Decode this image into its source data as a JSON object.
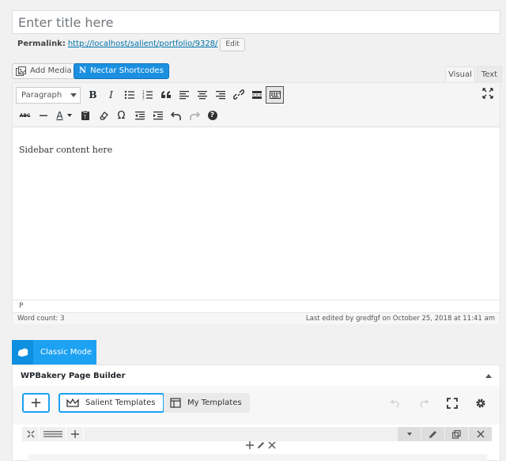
{
  "title_placeholder": "Enter title here",
  "permalink": {
    "label": "Permalink:",
    "url": "http://localhost/salient/portfolio/9328/",
    "edit_label": "Edit"
  },
  "media_buttons": {
    "add_media": "Add Media",
    "nectar_icon": "N",
    "nectar": "Nectar Shortcodes"
  },
  "editor_tabs": {
    "visual": "Visual",
    "text": "Text"
  },
  "toolbar": {
    "format_select": "Paragraph",
    "row1_icons": [
      "bold-icon",
      "italic-icon",
      "bullet-list-icon",
      "numbered-list-icon",
      "blockquote-icon",
      "align-left-icon",
      "align-center-icon",
      "align-right-icon",
      "link-icon",
      "read-more-icon",
      "toolbar-toggle-icon"
    ],
    "row2_icons": [
      "strikethrough-icon",
      "horizontal-line-icon",
      "text-color-icon",
      "paste-text-icon",
      "clear-formatting-icon",
      "special-character-icon",
      "outdent-icon",
      "indent-icon",
      "undo-icon",
      "redo-icon",
      "help-icon"
    ],
    "bold": "B",
    "italic": "I",
    "strike": "ABC",
    "text_color": "A",
    "omega": "Ω",
    "help": "?"
  },
  "editor_content": "Sidebar content here",
  "path": "P",
  "word_count": "Word count: 3",
  "last_edited": "Last edited by gredfgf on October 25, 2018 at 11:41 am",
  "classic_mode": "Classic Mode",
  "wpbakery": {
    "title": "WPBakery Page Builder",
    "add_element": "+",
    "salient_templates": "Salient Templates",
    "my_templates": "My Templates",
    "nav_icons": [
      "undo-icon",
      "redo-icon",
      "fullscreen-icon",
      "settings-icon"
    ],
    "row_icons": [
      "row-move-icon",
      "row-layout-icon",
      "add-column-icon"
    ],
    "row_right_icons": [
      "toggle-row-icon",
      "edit-row-icon",
      "clone-row-icon",
      "delete-row-icon"
    ],
    "column_icons": [
      "add-element-icon",
      "edit-column-icon",
      "delete-column-icon"
    ]
  },
  "colors": {
    "accent": "#1da1f2",
    "link": "#0073aa",
    "nectar_bg": "#1b8fe0"
  }
}
